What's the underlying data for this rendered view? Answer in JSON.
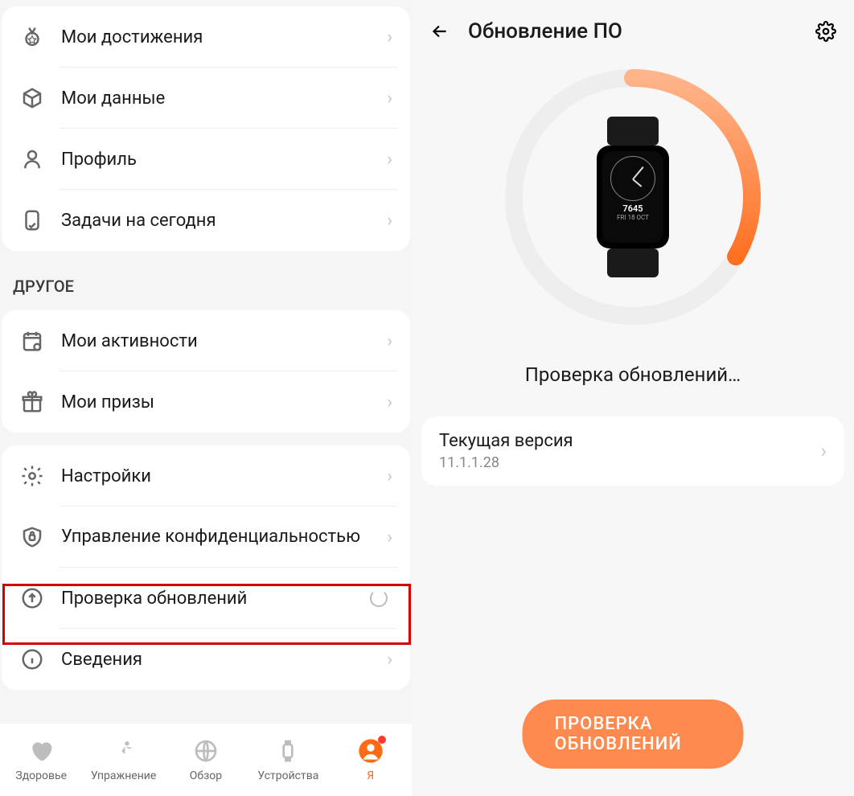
{
  "left": {
    "group1": [
      {
        "icon": "medal",
        "label": "Мои достижения"
      },
      {
        "icon": "cube",
        "label": "Мои данные"
      },
      {
        "icon": "person",
        "label": "Профиль"
      },
      {
        "icon": "phone-check",
        "label": "Задачи на сегодня"
      }
    ],
    "section_other": "ДРУГОЕ",
    "group2": [
      {
        "icon": "calendar",
        "label": "Мои активности"
      },
      {
        "icon": "gift",
        "label": "Мои призы"
      }
    ],
    "group3": [
      {
        "icon": "gear",
        "label": "Настройки"
      },
      {
        "icon": "shield-lock",
        "label": "Управление конфиденциальностью"
      },
      {
        "icon": "arrow-up-circle",
        "label": "Проверка обновлений",
        "loading": true
      },
      {
        "icon": "info",
        "label": "Сведения"
      }
    ],
    "tabs": [
      {
        "label": "Здоровье",
        "icon": "heart"
      },
      {
        "label": "Упражнение",
        "icon": "runner"
      },
      {
        "label": "Обзор",
        "icon": "globe"
      },
      {
        "label": "Устройства",
        "icon": "watch"
      },
      {
        "label": "Я",
        "icon": "user",
        "active": true,
        "dot": true
      }
    ]
  },
  "right": {
    "title": "Обновление ПО",
    "status": "Проверка обновлений…",
    "watch_steps": "7645",
    "watch_date": "FRI 18 OCT",
    "version_label": "Текущая версия",
    "version_value": "11.1.1.28",
    "button": "ПРОВЕРКА ОБНОВЛЕНИЙ",
    "accent": "#ff6a13"
  }
}
